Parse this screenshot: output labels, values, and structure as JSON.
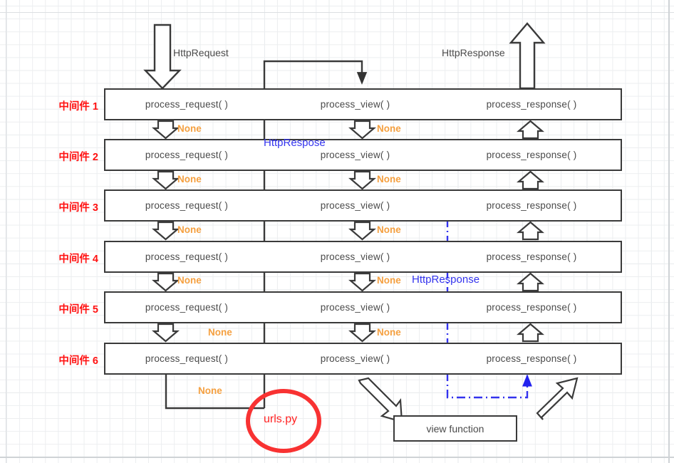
{
  "diagram": {
    "title_flows": {
      "request_label": "HttpRequest",
      "response_label": "HttpResponse"
    },
    "columns": {
      "request": "process_request( )",
      "view": "process_view( )",
      "response": "process_response( )"
    },
    "middlewares": [
      {
        "label": "中间件 1",
        "request": "process_request( )",
        "view": "process_view( )",
        "response": "process_response( )"
      },
      {
        "label": "中间件 2",
        "request": "process_request( )",
        "view": "process_view( )",
        "response": "process_response( )"
      },
      {
        "label": "中间件 3",
        "request": "process_request( )",
        "view": "process_view( )",
        "response": "process_response( )"
      },
      {
        "label": "中间件 4",
        "request": "process_request( )",
        "view": "process_view( )",
        "response": "process_response( )"
      },
      {
        "label": "中间件 5",
        "request": "process_request( )",
        "view": "process_view( )",
        "response": "process_response( )"
      },
      {
        "label": "中间件 6",
        "request": "process_request( )",
        "view": "process_view( )",
        "response": "process_response( )"
      }
    ],
    "none_labels": {
      "req_1_2": "None",
      "req_2_3": "None",
      "req_3_4": "None",
      "req_4_5": "None",
      "req_5_6": "None",
      "req_6_out": "None",
      "view_1_2": "None",
      "view_2_3": "None",
      "view_3_4": "None",
      "view_4_5": "None",
      "view_5_6": "None"
    },
    "annotations": {
      "http_respose_mw2": "HttpRespose",
      "http_response_mw5": "HttpResponse",
      "urls": "urls.py",
      "view_function": "view function"
    },
    "colors": {
      "box_border": "#3a3a3a",
      "text": "#4a4a4a",
      "label_red": "#ff1111",
      "none_orange": "#f5a040",
      "blue": "#3333ee",
      "urls_red": "#ff2222",
      "grid": "#e2e5e8",
      "background": "#ffffff"
    }
  }
}
